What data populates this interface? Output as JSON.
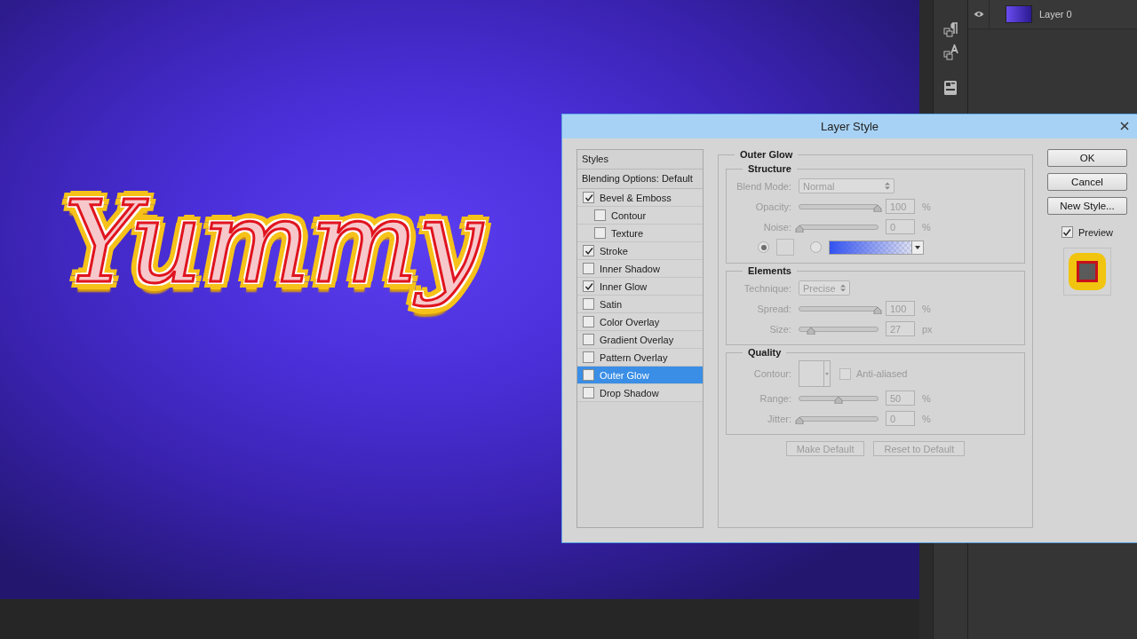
{
  "canvas": {
    "artwork_text": "Yummy"
  },
  "layers_panel": {
    "layers": [
      {
        "name": "Layer 0",
        "visible": true
      }
    ]
  },
  "dialog": {
    "title": "Layer Style",
    "styles_list": {
      "header": "Styles",
      "blending": "Blending Options: Default",
      "items": [
        {
          "label": "Bevel & Emboss",
          "checked": true,
          "selected": false,
          "children": [
            {
              "label": "Contour",
              "checked": false,
              "selected": false
            },
            {
              "label": "Texture",
              "checked": false,
              "selected": false
            }
          ]
        },
        {
          "label": "Stroke",
          "checked": true,
          "selected": false
        },
        {
          "label": "Inner Shadow",
          "checked": false,
          "selected": false
        },
        {
          "label": "Inner Glow",
          "checked": true,
          "selected": false
        },
        {
          "label": "Satin",
          "checked": false,
          "selected": false
        },
        {
          "label": "Color Overlay",
          "checked": false,
          "selected": false
        },
        {
          "label": "Gradient Overlay",
          "checked": false,
          "selected": false
        },
        {
          "label": "Pattern Overlay",
          "checked": false,
          "selected": false
        },
        {
          "label": "Outer Glow",
          "checked": false,
          "selected": true
        },
        {
          "label": "Drop Shadow",
          "checked": false,
          "selected": false
        }
      ]
    },
    "panel": {
      "title": "Outer Glow",
      "disabled": true,
      "groups": [
        {
          "title": "Structure",
          "rows": [
            {
              "kind": "select",
              "label": "Blend Mode:",
              "value": "Normal"
            },
            {
              "kind": "slider",
              "label": "Opacity:",
              "level": 1,
              "value": "100",
              "unit": "%"
            },
            {
              "kind": "slider",
              "label": "Noise:",
              "level": 0,
              "value": "0",
              "unit": "%"
            },
            {
              "kind": "fill",
              "color_selected": true,
              "gradient_selected": false
            }
          ]
        },
        {
          "title": "Elements",
          "rows": [
            {
              "kind": "select",
              "label": "Technique:",
              "value": "Precise"
            },
            {
              "kind": "slider",
              "label": "Spread:",
              "level": 1,
              "value": "100",
              "unit": "%"
            },
            {
              "kind": "slider",
              "label": "Size:",
              "level": 0.15,
              "value": "27",
              "unit": "px"
            }
          ]
        },
        {
          "title": "Quality",
          "rows": [
            {
              "kind": "contour",
              "label": "Contour:",
              "checkbox_label": "Anti-aliased",
              "checked": false
            },
            {
              "kind": "slider",
              "label": "Range:",
              "level": 0.5,
              "value": "50",
              "unit": "%"
            },
            {
              "kind": "slider",
              "label": "Jitter:",
              "level": 0,
              "value": "0",
              "unit": "%"
            }
          ]
        }
      ],
      "buttons": [
        "Make Default",
        "Reset to Default"
      ]
    },
    "buttons": [
      "OK",
      "Cancel",
      "New Style..."
    ],
    "preview": {
      "label": "Preview",
      "checked": true
    }
  }
}
